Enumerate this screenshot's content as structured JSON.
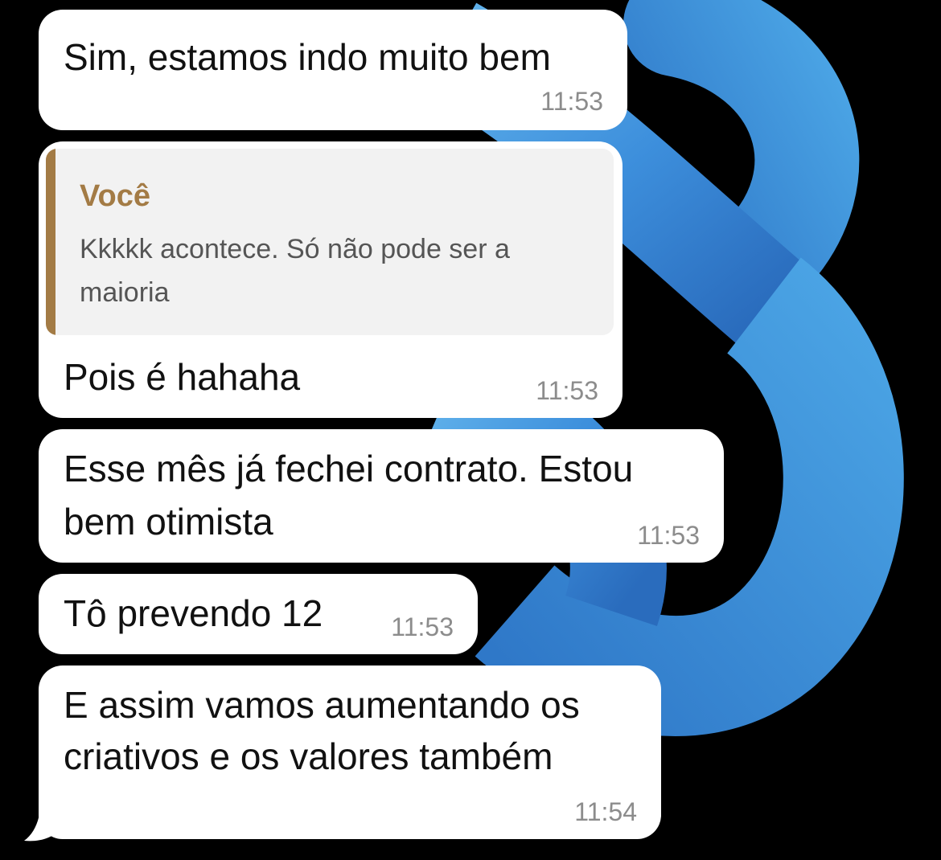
{
  "colors": {
    "background": "#000000",
    "bubble": "#ffffff",
    "quote_accent": "#a37b45",
    "quote_background": "#f2f2f2",
    "wallpaper_blue_light": "#4a9ee0",
    "wallpaper_blue_dark": "#2b6fc0"
  },
  "messages": [
    {
      "text": "Sim, estamos indo muito bem",
      "time": "11:53"
    },
    {
      "quote": {
        "author": "Você",
        "text": "Kkkkk acontece. Só não pode ser a maioria"
      },
      "text": "Pois é hahaha",
      "time": "11:53"
    },
    {
      "lines": [
        "Esse mês já fechei contrato. Estou",
        "bem otimista"
      ],
      "time": "11:53"
    },
    {
      "text": "Tô prevendo 12",
      "time": "11:53"
    },
    {
      "lines": [
        "E assim vamos aumentando os",
        "criativos e os valores também"
      ],
      "time": "11:54"
    }
  ]
}
